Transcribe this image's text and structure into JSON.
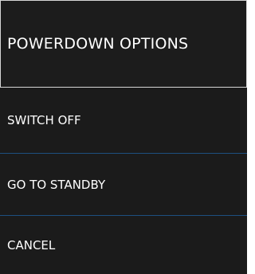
{
  "menu": {
    "title": "POWERDOWN OPTIONS",
    "items": [
      {
        "label": "SWITCH OFF"
      },
      {
        "label": "GO TO STANDBY"
      },
      {
        "label": "CANCEL"
      }
    ]
  },
  "colors": {
    "background": "#1b1b1b",
    "header_border": "#d6d6d6",
    "divider": "#1e4f80",
    "text": "#ffffff"
  }
}
